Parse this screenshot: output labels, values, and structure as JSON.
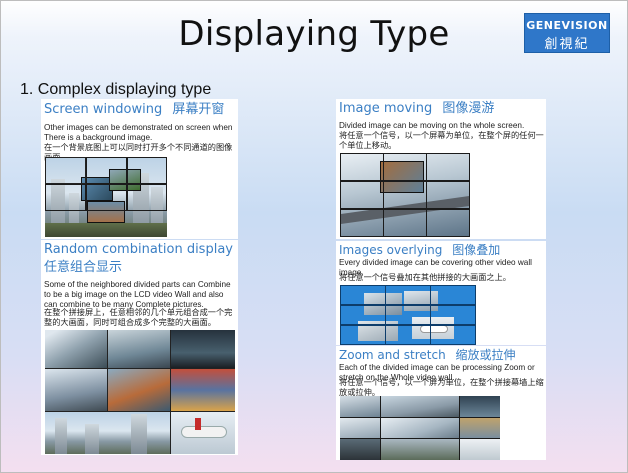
{
  "slide": {
    "title": "Displaying Type",
    "logo_text": "GENEVISION",
    "logo_cn": "創視紀",
    "subtitle": "1. Complex displaying type"
  },
  "panels": {
    "screen_windowing": {
      "heading_en": "Screen windowing",
      "heading_cn": "屏幕开窗",
      "desc_en": "Other images can be demonstrated on screen when There is a background image.",
      "desc_cn": "在一个背景底图上可以同时打开多个不同通道的图像画面。"
    },
    "random_combination": {
      "heading_en": "Random combination display",
      "heading_cn": "任意组合显示",
      "desc_en": "Some of the neighbored divided parts can Combine to be a big image on the LCD video Wall and also can combine to be many Complete pictures.",
      "desc_cn": "在整个拼接屏上，任意相邻的几个单元组合成一个完整的大画面，同时可组合成多个完整的大画面。"
    },
    "image_moving": {
      "heading_en": "Image moving",
      "heading_cn": "图像漫游",
      "desc_en": "Divided image can be moving on the whole screen.",
      "desc_cn": "将任意一个信号，以一个屏幕为单位，在整个屏的任何一个单位上移动。"
    },
    "images_overlying": {
      "heading_en": "Images overlying",
      "heading_cn": "图像叠加",
      "desc_en": "Every divided image can be covering other video wall image.",
      "desc_cn": "将任意一个信号叠加在其他拼接的大画面之上。"
    },
    "zoom_stretch": {
      "heading_en": "Zoom and stretch",
      "heading_cn": "缩放或拉伸",
      "desc_en": "Each of the divided image can be processing Zoom or stretch on the Whole video wall.",
      "desc_cn": "将任意一个信号，以一个屏为单位，在整个拼接幕墙上缩放或拉伸。"
    }
  },
  "colors": {
    "heading_blue": "#3b7fc4",
    "logo_bg": "#2f77c9"
  }
}
